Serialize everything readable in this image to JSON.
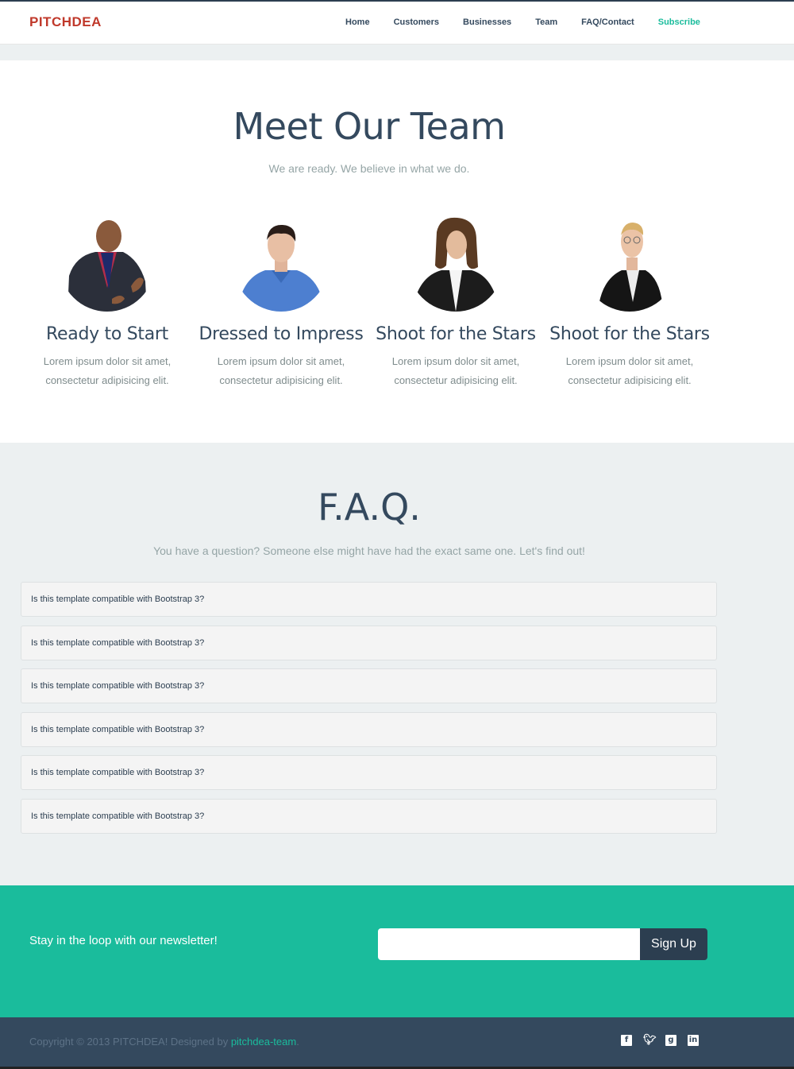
{
  "navbar": {
    "brand": "PITCHDEA",
    "links": [
      "Home",
      "Customers",
      "Businesses",
      "Team",
      "FAQ/Contact",
      "Subscribe"
    ]
  },
  "team": {
    "title": "Meet Our Team",
    "subtitle": "We are ready. We believe in what we do.",
    "members": [
      {
        "name": "Ready to Start",
        "desc1": "Lorem ipsum dolor sit amet,",
        "desc2": "consectetur adipisicing elit."
      },
      {
        "name": "Dressed to Impress",
        "desc1": "Lorem ipsum dolor sit amet,",
        "desc2": "consectetur adipisicing elit."
      },
      {
        "name": "Shoot for the Stars",
        "desc1": "Lorem ipsum dolor sit amet,",
        "desc2": "consectetur adipisicing elit."
      },
      {
        "name": "Shoot for the Stars",
        "desc1": "Lorem ipsum dolor sit amet,",
        "desc2": "consectetur adipisicing elit."
      }
    ]
  },
  "faq": {
    "title": "F.A.Q.",
    "subtitle": "You have a question? Someone else might have had the exact same one. Let's find out!",
    "items": [
      "Is this template compatible with Bootstrap 3?",
      "Is this template compatible with Bootstrap 3?",
      "Is this template compatible with Bootstrap 3?",
      "Is this template compatible with Bootstrap 3?",
      "Is this template compatible with Bootstrap 3?",
      "Is this template compatible with Bootstrap 3?"
    ]
  },
  "newsletter": {
    "text": "Stay in the loop with our newsletter!",
    "input_value": "",
    "button": "Sign Up"
  },
  "footer": {
    "copyright": "Copyright © 2013 PITCHDEA! Designed by ",
    "designer_link": "pitchdea-team",
    "period": ".",
    "social_icons": [
      "facebook-icon",
      "twitter-icon",
      "google-plus-icon",
      "linkedin-icon"
    ]
  },
  "colors": {
    "brand": "#c0392b",
    "accent": "#1abc9c",
    "dark": "#34495e",
    "light_bg": "#ecf0f1"
  }
}
